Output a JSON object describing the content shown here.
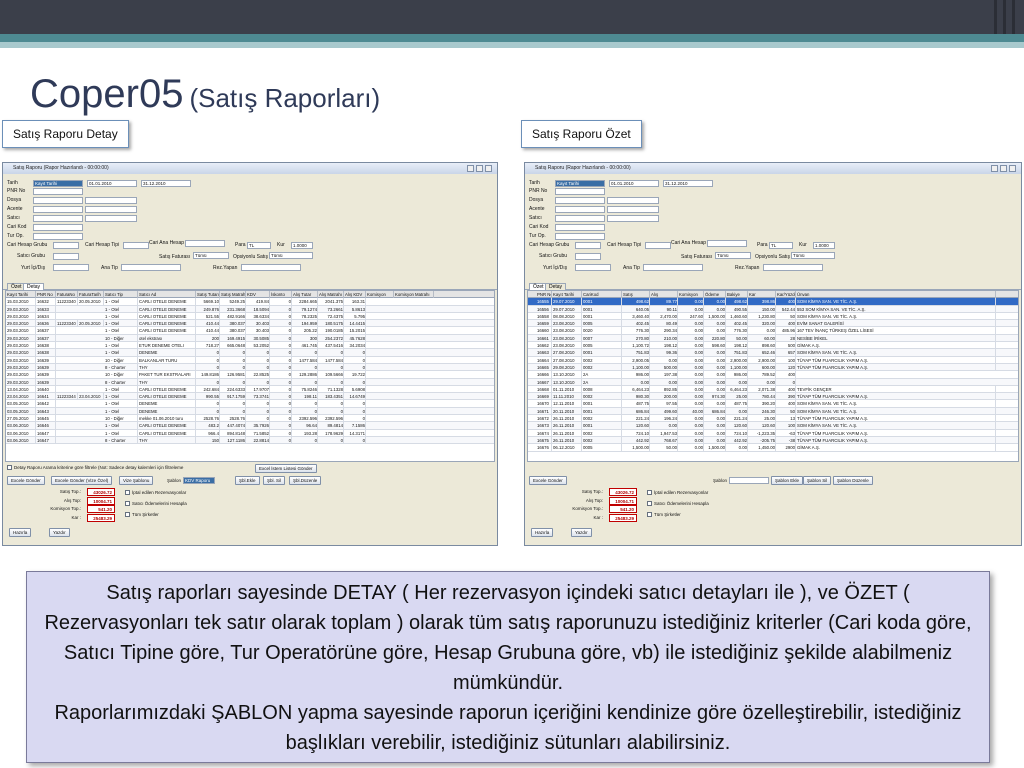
{
  "slide": {
    "title": "Coper05",
    "subtitle": "(Satış Raporları)",
    "tag_left": "Satış Raporu Detay",
    "tag_right": "Satış Raporu Özet"
  },
  "colors": {
    "header_dark": "#3b3f4a",
    "header_teal": "#4e8a92",
    "title": "#2f3a58",
    "desc_bg": "#d9d9f2",
    "grid_select": "#316ac5"
  },
  "window": {
    "title": "Satış Raporu (Rapor Hazırlandı - 00:00:00)",
    "labels": {
      "tarih": "Tarih",
      "pnr": "PNR No",
      "dosya": "Dosya",
      "acente": "Acente",
      "satici": "Satıcı",
      "cari_kod": "Cari Kod",
      "tur_op": "Tur Op.",
      "cari_hesap_grubu": "Cari Hesap Grubu",
      "cari_hesap_tipi": "Cari Hesap Tipi",
      "cari_ana_hesap": "Cari Ana Hesap",
      "para": "Para",
      "kur": "Kur",
      "satici_grubu": "Satıcı Grubu",
      "satis_faturasi": "Satış Faturası",
      "opsiyonlu_satis": "Opsiyonlu Satış",
      "yurt_ici_dis": "Yurt İçi/Dış",
      "ana_tip": "Ana Tip",
      "rez_yapan": "Rez.Yapan"
    },
    "values": {
      "tarih_tipi": "Kayıt Tarihi",
      "date_from": "01.01.2010",
      "date_to": "31.12.2010",
      "para": "TL",
      "kur": "1.0000",
      "satis_faturasi": "Tümü",
      "opsiyonlu_satis": "Tümü"
    },
    "tabs": {
      "ozet": "Özet",
      "detay": "Detay"
    }
  },
  "detail": {
    "headers": [
      "Kayıt Tarihi",
      "PNR No",
      "FaturaNo",
      "FaturaTarih",
      "Satıcı Tip",
      "Satıcı Ad",
      "Satış Tutarı",
      "Satış Matrahı",
      "KDV",
      "İskonto",
      "Alış Tutar",
      "Alış Matrahı",
      "Alış KDV",
      "Komisyon",
      "Komisyon Matrahı"
    ],
    "rows": [
      [
        "15.03.2010",
        "16632",
        "11223340",
        "20.05.2010",
        "1 - Otel",
        "CARLI OTELE DENEME",
        "5669.10",
        "5249.25",
        "419.84",
        "0",
        "2284.665",
        "2041.375",
        "163.31",
        "",
        ""
      ],
      [
        "29.03.2010",
        "16633",
        "",
        "",
        "1 - Otel",
        "CARLI OTELE DENEME",
        "249.876",
        "231.3668",
        "18.5094",
        "0",
        "79.1274",
        "73.2661",
        "5.8613",
        "",
        ""
      ],
      [
        "29.03.2010",
        "16634",
        "",
        "",
        "1 - Otel",
        "CARLI OTELE DENEME",
        "521.55",
        "482.9166",
        "38.6334",
        "0",
        "78.2325",
        "72.4375",
        "5.795",
        "",
        ""
      ],
      [
        "29.03.2010",
        "16636",
        "11223340",
        "20.05.2010",
        "1 - Otel",
        "CARLI OTELE DENEME",
        "410.44",
        "380.037",
        "30.403",
        "0",
        "194.959",
        "180.5175",
        "14.4415",
        "",
        ""
      ],
      [
        "29.03.2010",
        "16637",
        "",
        "",
        "1 - Otel",
        "CARLI OTELE DENEME",
        "410.44",
        "380.037",
        "30.403",
        "0",
        "205.22",
        "190.0185",
        "15.2015",
        "",
        ""
      ],
      [
        "29.03.2010",
        "16637",
        "",
        "",
        "10 - Diğer",
        "otel ekstrası",
        "200",
        "169.4915",
        "30.5085",
        "0",
        "300",
        "254.2372",
        "45.7628",
        "",
        ""
      ],
      [
        "29.03.2010",
        "16638",
        "",
        "",
        "1 - Otel",
        "ETUR DENEME OTELI",
        "718.27",
        "665.0648",
        "53.2052",
        "0",
        "461.745",
        "437.5416",
        "34.2034",
        "",
        ""
      ],
      [
        "29.03.2010",
        "16638",
        "",
        "",
        "1 - Otel",
        "DENEME",
        "0",
        "0",
        "0",
        "0",
        "0",
        "0",
        "0",
        "",
        ""
      ],
      [
        "29.03.2010",
        "16639",
        "",
        "",
        "10 - Diğer",
        "BALKANLAR TURU",
        "0",
        "0",
        "0",
        "0",
        "1477.584",
        "1477.584",
        "0",
        "",
        ""
      ],
      [
        "29.03.2010",
        "16639",
        "",
        "",
        "8 - Charter",
        "THY",
        "0",
        "0",
        "0",
        "0",
        "0",
        "0",
        "0",
        "",
        ""
      ],
      [
        "29.03.2010",
        "16639",
        "",
        "",
        "10 - Diğer",
        "PAKET TUR EKSTRALARI",
        "149.8186",
        "126.9581",
        "22.8525",
        "0",
        "129.2886",
        "109.5666",
        "19.722",
        "",
        ""
      ],
      [
        "29.03.2010",
        "16639",
        "",
        "",
        "8 - Charter",
        "THY",
        "0",
        "0",
        "0",
        "0",
        "0",
        "0",
        "0",
        "",
        ""
      ],
      [
        "13.04.2010",
        "16640",
        "",
        "",
        "1 - Otel",
        "CARLI OTELE DENEME",
        "242.684",
        "224.6333",
        "17.9707",
        "0",
        "75.8246",
        "71.1328",
        "5.6908",
        "",
        ""
      ],
      [
        "23.04.2010",
        "16641",
        "11223344",
        "23.04.2010",
        "1 - Otel",
        "CARLI OTELE DENEME",
        "990.55",
        "917.1759",
        "73.3741",
        "0",
        "198.11",
        "183.4351",
        "14.6749",
        "",
        ""
      ],
      [
        "03.05.2010",
        "16642",
        "",
        "",
        "1 - Otel",
        "DENEME",
        "0",
        "0",
        "0",
        "0",
        "0",
        "0",
        "0",
        "",
        ""
      ],
      [
        "03.05.2010",
        "16643",
        "",
        "",
        "1 - Otel",
        "DENEME",
        "0",
        "0",
        "0",
        "0",
        "0",
        "0",
        "0",
        "",
        ""
      ],
      [
        "27.05.2010",
        "16645",
        "",
        "",
        "10 - Diğer",
        "mekke 01.06.2010 turu",
        "2528.76",
        "2528.76",
        "0",
        "0",
        "2392.596",
        "2392.596",
        "0",
        "",
        ""
      ],
      [
        "03.06.2010",
        "16646",
        "",
        "",
        "1 - Otel",
        "CARLI OTELE DENEME",
        "483.2",
        "447.4074",
        "35.7926",
        "0",
        "96.64",
        "89.4814",
        "7.1586",
        "",
        ""
      ],
      [
        "03.06.2010",
        "16647",
        "",
        "",
        "1 - Otel",
        "CARLI OTELE DENEME",
        "966.4",
        "894.8148",
        "71.5852",
        "0",
        "193.28",
        "178.9629",
        "14.3171",
        "",
        ""
      ],
      [
        "03.06.2010",
        "16647",
        "",
        "",
        "8 - Charter",
        "THY",
        "150",
        "127.1186",
        "22.8814",
        "0",
        "0",
        "0",
        "0",
        "",
        ""
      ]
    ]
  },
  "summary": {
    "headers": [
      "PNR No",
      "Kayıt Tarihi",
      "CariKod",
      "Satış",
      "Alış",
      "Komisyon",
      "Ödeme",
      "Bakiye",
      "Kar",
      "Kar/Yüzde",
      "Ünvan"
    ],
    "rows": [
      [
        "16555",
        "29.07.2010",
        "0001",
        "498.62",
        "89.77",
        "0.00",
        "0.00",
        "498.62",
        "398.86",
        "400",
        "SOM KİMYA SAN. VE TİC. A.Ş."
      ],
      [
        "16556",
        "29.07.2010",
        "0001",
        "640.05",
        "90.11",
        "0.00",
        "0.00",
        "490.55",
        "150.00",
        "542.44",
        "553 SOM KİMYA SAN. VE TİC. A.Ş."
      ],
      [
        "16558",
        "08.08.2010",
        "0001",
        "3,460.40",
        "2,470.00",
        "247.60",
        "1,500.00",
        "1,460.60",
        "1,230.80",
        "50",
        "SOM KİMYA SAN. VE TİC. A.Ş."
      ],
      [
        "16659",
        "23.08.2010",
        "0005",
        "402.45",
        "80.49",
        "0.00",
        "0.00",
        "402.45",
        "320.00",
        "400",
        "EVİM SANAT GALERİSİ"
      ],
      [
        "16660",
        "23.08.2010",
        "0020",
        "776.30",
        "290.34",
        "0.00",
        "0.00",
        "776.30",
        "0.00",
        "485.96",
        "167 TEV İNANÇ TÜRKEŞ ÖZEL LİSESİ"
      ],
      [
        "16661",
        "23.08.2010",
        "0007",
        "270.80",
        "210.00",
        "0.00",
        "220.80",
        "50.00",
        "60.00",
        "28",
        "NESİBE İRİKEL"
      ],
      [
        "16662",
        "23.08.2010",
        "0005",
        "1,100.72",
        "198.12",
        "0.00",
        "598.60",
        "198.12",
        "898.60",
        "500",
        "GİMAK A.Ş."
      ],
      [
        "16663",
        "27.08.2010",
        "0001",
        "751.83",
        "99.36",
        "0.00",
        "0.00",
        "751.83",
        "652.46",
        "657",
        "SOM KİMYA SAN. VE TİC. A.Ş."
      ],
      [
        "16664",
        "27.08.2010",
        "0002",
        "2,900.05",
        "0.00",
        "0.00",
        "0.00",
        "2,900.00",
        "2,900.00",
        "100",
        "TÜYAP TÜM FUARCILIK YAPIM A.Ş."
      ],
      [
        "16665",
        "29.08.2010",
        "0002",
        "1,100.00",
        "500.00",
        "0.00",
        "0.00",
        "1,100.00",
        "600.00",
        "120",
        "TÜYAP TÜM FUARCILIK YAPIM A.Ş."
      ],
      [
        "16666",
        "13.10.2010",
        "2A",
        "986.00",
        "197.38",
        "0.00",
        "0.00",
        "986.00",
        "789.52",
        "400",
        ""
      ],
      [
        "16667",
        "13.10.2010",
        "2A",
        "0.00",
        "0.00",
        "0.00",
        "0.00",
        "0.00",
        "0.00",
        "0",
        ""
      ],
      [
        "16668",
        "01.11.2010",
        "0008",
        "6,464.23",
        "892.85",
        "0.00",
        "0.00",
        "6,464.23",
        "2,071.38",
        "400",
        "TEVFİK GENÇER"
      ],
      [
        "16669",
        "11.11.2010",
        "0002",
        "980.30",
        "200.00",
        "0.00",
        "974.30",
        "25.00",
        "780.44",
        "390",
        "TÜYAP TÜM FUARCILIK YAPIM A.Ş."
      ],
      [
        "16670",
        "12.11.2010",
        "0001",
        "487.75",
        "97.55",
        "0.00",
        "0.00",
        "487.75",
        "390.20",
        "400",
        "SOM KİMYA SAN. VE TİC. A.Ş."
      ],
      [
        "16671",
        "20.11.2010",
        "0001",
        "686.84",
        "499.60",
        "40.00",
        "686.84",
        "0.00",
        "246.30",
        "50",
        "SOM KİMYA SAN. VE TİC. A.Ş."
      ],
      [
        "16672",
        "26.11.2010",
        "0002",
        "221.24",
        "196.24",
        "0.00",
        "0.00",
        "221.24",
        "25.00",
        "13",
        "TÜYAP TÜM FUARCILIK YAPIM A.Ş."
      ],
      [
        "16673",
        "26.11.2010",
        "0001",
        "120.60",
        "0.00",
        "0.00",
        "0.00",
        "120.60",
        "120.60",
        "100",
        "SOM KİMYA SAN. VE TİC. A.Ş."
      ],
      [
        "16674",
        "26.11.2010",
        "0002",
        "724.10",
        "1,947.53",
        "0.00",
        "0.00",
        "724.10",
        "-1,223.35",
        "-63",
        "TÜYAP TÜM FUARCILIK YAPIM A.Ş."
      ],
      [
        "16675",
        "26.11.2010",
        "0002",
        "442.92",
        "768.67",
        "0.00",
        "0.00",
        "442.92",
        "-205.75",
        "-38",
        "TÜYAP TÜM FUARCILIK YAPIM A.Ş."
      ],
      [
        "16676",
        "06.12.2010",
        "0005",
        "1,500.00",
        "50.00",
        "0.00",
        "1,500.00",
        "0.00",
        "1,450.00",
        "2900",
        "GİMAK A.Ş."
      ]
    ]
  },
  "footer": {
    "filter_note": "Detay Raporu Arama kriterine göre filtrele (Not: Sadece detay kalemleri için filtreleme",
    "btn_excel_columns": "Excel İstem Listesi Gönder",
    "btn_excel": "Excele Gönder",
    "btn_excel_vize": "Excele Gönder (Vize Özel)",
    "btn_vize_sablon": "Vize Şablonu",
    "sablon_label": "Şablon",
    "sablon_value": "KDV Raporu",
    "btn_sablon_ekle": "Şbl.Ekle",
    "btn_sablon_sil": "Şbl. Sil",
    "btn_sablon_duzenle": "Şbl.Düzenle",
    "btn_sablon_ekle_long": "Şablon Ekle",
    "btn_sablon_sil_long": "Şablon Sil",
    "btn_sablon_duzenle_long": "Şablon Düzenle",
    "satis_top_label": "Satış Top.:",
    "alis_top_label": "Alış Top:",
    "komisyon_top_label": "Komisyon Top.:",
    "kar_label": "Kar :",
    "satis_top": "43026.72",
    "alis_top": "10004.71",
    "komisyon_top": "541.20",
    "kar": "25483.29",
    "chk_iptal": "İptal edilen Rezervasyonlar",
    "chk_satici_odeme": "Satıcı Ödemelerini Hesapla",
    "chk_tum_sirketler": "Tüm Şirketler",
    "btn_hazirla": "Hazırla",
    "btn_yazdir": "Yazdır"
  },
  "description": {
    "line1": "Satış raporları sayesinde DETAY ( Her rezervasyon içindeki satıcı detayları ile ), ve ÖZET ( Rezervasyonları tek satır olarak toplam ) olarak tüm satış raporunuzu istediğiniz kriterler (Cari koda göre, Satıcı Tipine göre, Tur Operatörüne göre, Hesap Grubuna göre, vb) ile istediğiniz şekilde alabilmeniz mümkündür.",
    "line2": "Raporlarımızdaki ŞABLON yapma sayesinde raporun içeriğini kendinize göre özelleştirebilir, istediğiniz başlıkları verebilir, istediğiniz sütunları alabilirsiniz."
  }
}
